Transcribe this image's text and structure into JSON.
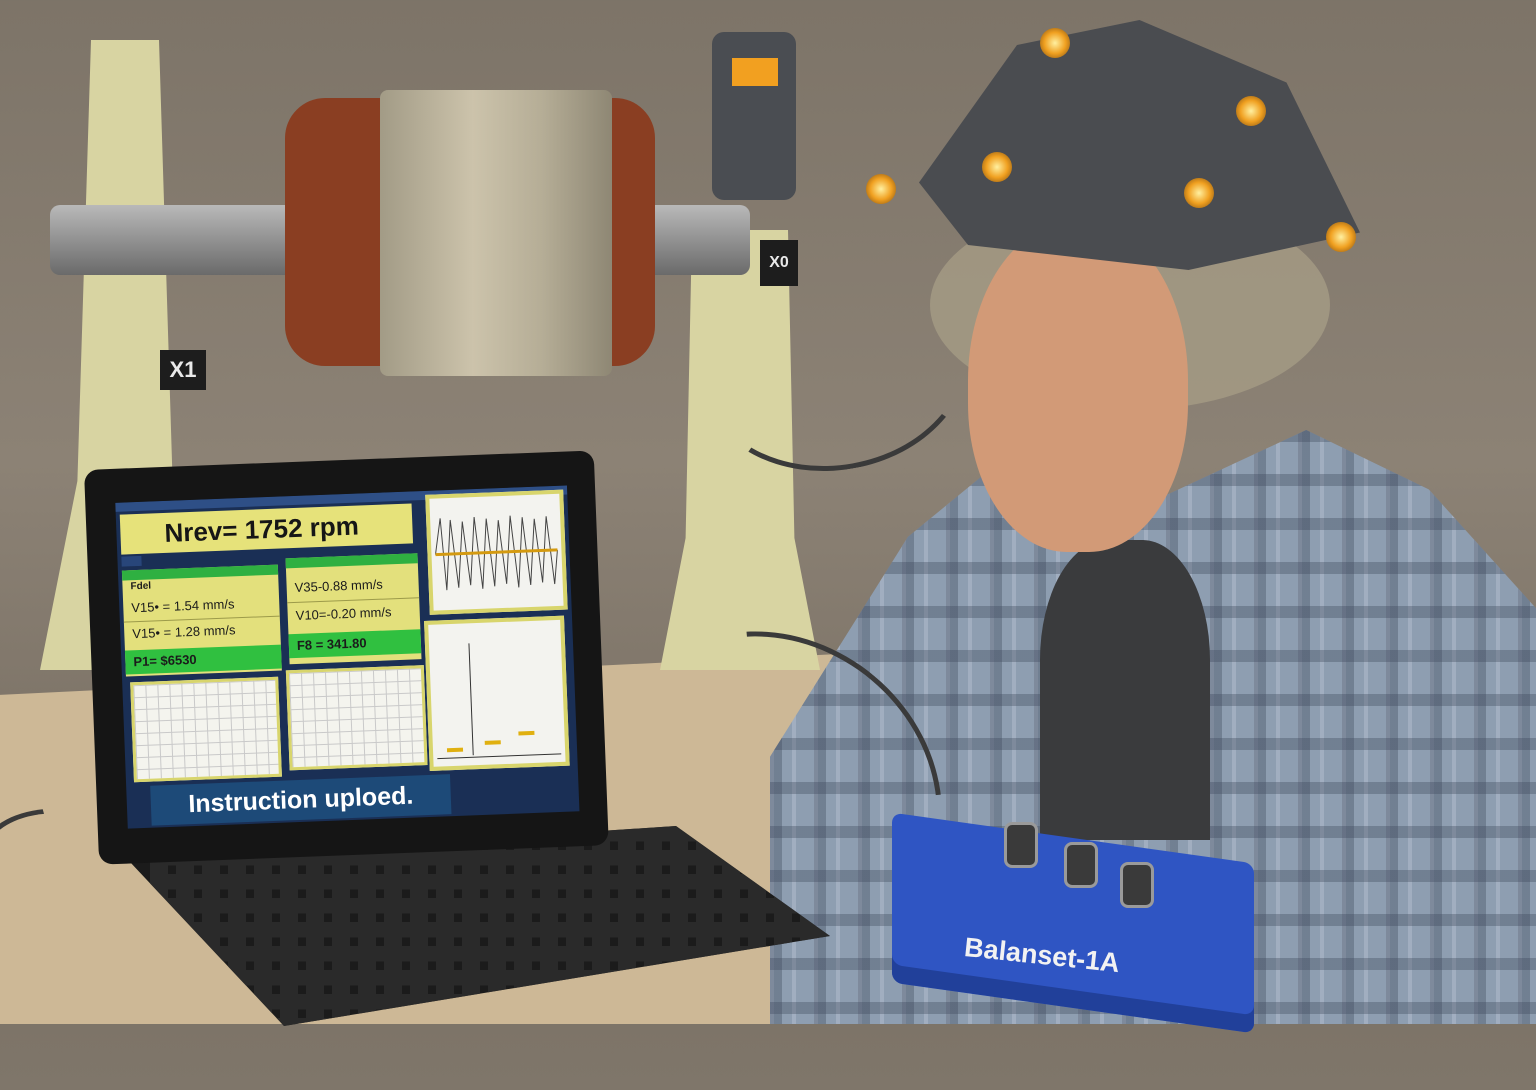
{
  "stand_labels": {
    "left": "X1",
    "right": "X0"
  },
  "laptop": {
    "rpm_text": "Nrev= 1752 rpm",
    "panel_left": {
      "title": "Fdel",
      "rows": [
        "V15• = 1.54 mm/s",
        "V15• = 1.28 mm/s",
        "P1= $6530"
      ]
    },
    "panel_right": {
      "rows": [
        "V35-0.88 mm/s",
        "V10=-0.20 mm/s",
        "F8 = 341.80"
      ]
    },
    "status_text": "Instruction uploed."
  },
  "device": {
    "label": "Balanset-1A"
  },
  "colors": {
    "panel_yellow": "#e3e07c",
    "panel_green": "#30c040",
    "device_blue": "#2f55c3"
  }
}
